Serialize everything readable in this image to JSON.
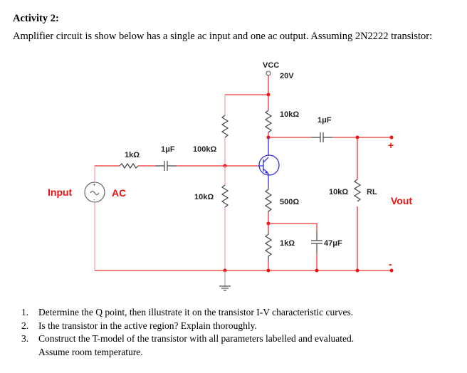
{
  "document": {
    "heading": "Activity 2:",
    "intro": "Amplifier circuit is show below has a single ac input and one ac output. Assuming 2N2222 transistor:"
  },
  "circuit": {
    "supply": {
      "name": "VCC",
      "value": "20V"
    },
    "input": {
      "label": "Input",
      "source_label": "AC"
    },
    "input_resistor": "1kΩ",
    "input_capacitor": "1μF",
    "bias_resistor_top": "100kΩ",
    "bias_resistor_bottom": "10kΩ",
    "collector_resistor": "10kΩ",
    "output_capacitor": "1μF",
    "emitter_resistor_1": "500Ω",
    "emitter_resistor_2": "1kΩ",
    "bypass_capacitor": "47μF",
    "load_resistor": {
      "value": "10kΩ",
      "name": "RL"
    },
    "output": {
      "label": "Vout",
      "plus": "+",
      "minus": "-"
    },
    "colors": {
      "wire": "#ee3333",
      "wire_light": "#f7a8a8",
      "transistor": "#3333dd",
      "component": "#444444",
      "label_red": "#ee1111"
    }
  },
  "questions": [
    {
      "num": "1.",
      "text": "Determine the Q point, then illustrate it on the transistor I-V characteristic  curves."
    },
    {
      "num": "2.",
      "text": "Is the transistor in the active region? Explain thoroughly."
    },
    {
      "num": "3.",
      "text": "Construct the T-model of the transistor with all parameters labelled and evaluated.",
      "continuation": "Assume room temperature."
    }
  ]
}
